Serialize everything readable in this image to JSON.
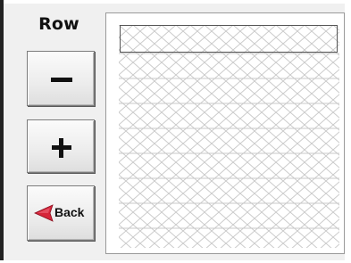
{
  "panel": {
    "title": "Row"
  },
  "buttons": {
    "decrement_icon": "minus-icon",
    "increment_icon": "plus-icon",
    "back_label": "Back",
    "back_icon": "left-arrow-icon"
  },
  "grid": {
    "selected_row": 1
  },
  "colors": {
    "back_arrow": "#d6253a",
    "pattern_line": "#c8c8c8",
    "button_face": "#ececec"
  }
}
